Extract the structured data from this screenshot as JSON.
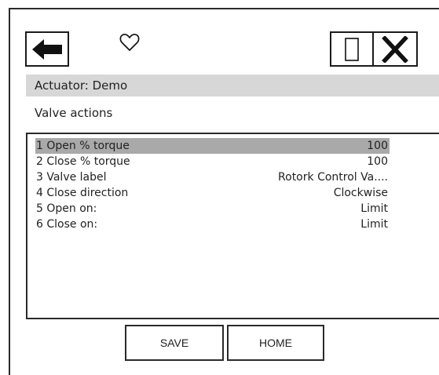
{
  "header": {
    "back_icon": "back-arrow-icon",
    "favorite_icon": "heart-outline-icon",
    "window_icon": "blank-box-icon",
    "close_icon": "close-x-icon"
  },
  "actuator": {
    "title": "Actuator: Demo"
  },
  "section": {
    "title": "Valve actions"
  },
  "settings": {
    "items": [
      {
        "label": "1 Open % torque",
        "value": "100",
        "selected": true
      },
      {
        "label": "2 Close % torque",
        "value": "100",
        "selected": false
      },
      {
        "label": "3 Valve label",
        "value": "Rotork Control Va....",
        "selected": false
      },
      {
        "label": "4 Close direction",
        "value": "Clockwise",
        "selected": false
      },
      {
        "label": "5 Open on:",
        "value": "Limit",
        "selected": false
      },
      {
        "label": "6 Close on:",
        "value": "Limit",
        "selected": false
      }
    ]
  },
  "footer": {
    "save_label": "SAVE",
    "home_label": "HOME"
  },
  "colors": {
    "title_bar": "#d7d7d7",
    "selected_row": "#a9a9a9",
    "border": "#2a2a2a"
  }
}
